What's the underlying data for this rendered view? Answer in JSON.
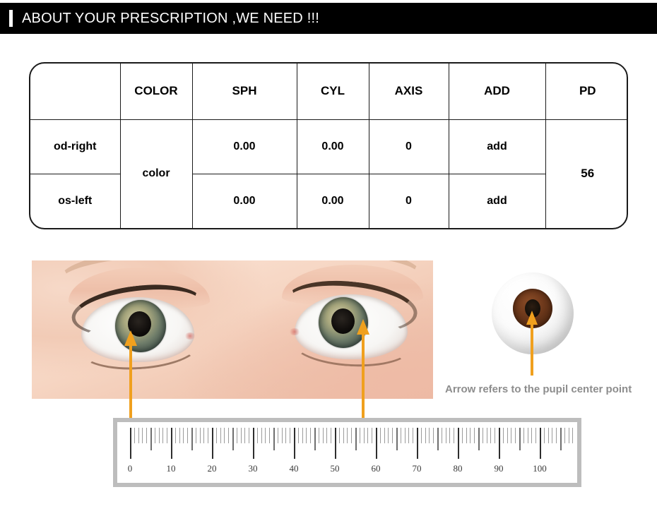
{
  "header": {
    "title": "ABOUT YOUR PRESCRIPTION ,WE NEED !!!",
    "accent_color": "#000000",
    "text_color": "#ffffff"
  },
  "prescription_table": {
    "columns": [
      "",
      "COLOR",
      "SPH",
      "CYL",
      "AXIS",
      "ADD",
      "PD"
    ],
    "rows": [
      {
        "eye": "od-right",
        "color": "color",
        "sph": "0.00",
        "cyl": "0.00",
        "axis": "0",
        "add": "add",
        "pd": "56"
      },
      {
        "eye": "os-left",
        "color": "color",
        "sph": "0.00",
        "cyl": "0.00",
        "axis": "0",
        "add": "add",
        "pd": "56"
      }
    ],
    "merged_cells": [
      "color",
      "pd"
    ]
  },
  "illustration": {
    "eye_photo_alt": "close-up photo of a pair of human eyes",
    "eyeball_diagram_alt": "3D eyeball with brown iris and dark pupil",
    "pupil_caption": "Arrow refers to the pupil center point",
    "caption_color": "#8d8d8d",
    "arrow_color": "#f0a01e"
  },
  "ruler": {
    "unit": "mm",
    "min": 0,
    "max": 110,
    "major_step": 10,
    "minor_step": 5,
    "tick_step": 1,
    "labels": [
      "0",
      "10",
      "20",
      "30",
      "40",
      "50",
      "60",
      "70",
      "80",
      "90",
      "100"
    ],
    "frame_color": "#bdbdbd",
    "face_color": "#ffffff"
  }
}
